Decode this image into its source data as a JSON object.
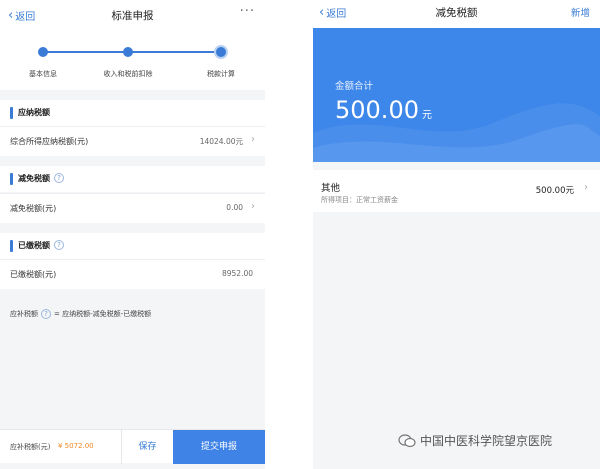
{
  "left": {
    "nav": {
      "back_label": "返回",
      "title": "标准申报",
      "more": "···"
    },
    "steps": [
      "基本信息",
      "收入和税前扣除",
      "税款计算"
    ],
    "tax_payable": {
      "section": "应纳税额",
      "label": "综合所得应纳税额(元)",
      "value": "14024.00元"
    },
    "tax_reduction": {
      "section": "减免税额",
      "label": "减免税额(元)",
      "value": "0.00"
    },
    "tax_paid": {
      "section": "已缴税额",
      "label": "已缴税额(元)",
      "value": "8952.00"
    },
    "formula": {
      "label": "应补税额",
      "expression": "= 应纳税额-减免税额-已缴税额"
    },
    "bottom": {
      "due_label": "应补税额(元)",
      "due_value": "¥ 5072.00",
      "save_label": "保存",
      "submit_label": "提交申报"
    }
  },
  "right": {
    "nav": {
      "back_label": "返回",
      "title": "减免税额",
      "add_label": "新增"
    },
    "summary": {
      "label": "金额合计",
      "amount": "500.00",
      "unit": "元"
    },
    "item": {
      "name": "其他",
      "sub": "所得项目：正常工资薪金",
      "amount": "500.00元"
    }
  },
  "watermark": "中国中医科学院望京医院",
  "colors": {
    "accent": "#3a7bd5",
    "hero": "#3d86ea",
    "due": "#f08a24"
  }
}
